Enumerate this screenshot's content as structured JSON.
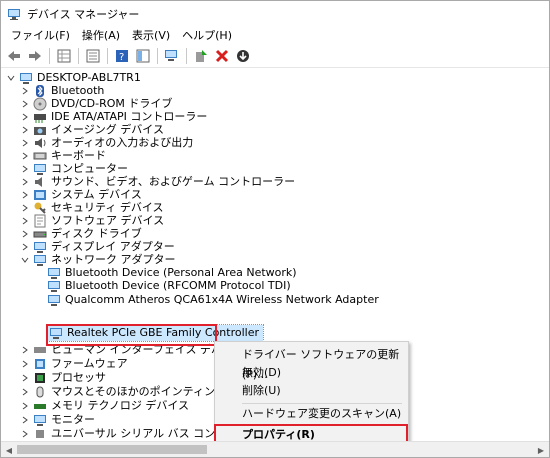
{
  "window": {
    "title": "デバイス マネージャー"
  },
  "menu": [
    "ファイル(F)",
    "操作(A)",
    "表示(V)",
    "ヘルプ(H)"
  ],
  "toolbar": [
    "back-icon",
    "forward-icon",
    "sep",
    "properties-grid-icon",
    "sep",
    "view-icon",
    "sep",
    "help-icon",
    "console-tree-icon",
    "sep",
    "scan-hardware-icon",
    "sep",
    "add-driver-icon",
    "uninstall-icon",
    "update-driver-icon"
  ],
  "tree": {
    "root": "DESKTOP-ABL7TR1",
    "categories": [
      {
        "label": "Bluetooth",
        "icon": "bluetooth-icon"
      },
      {
        "label": "DVD/CD-ROM ドライブ",
        "icon": "dvd-drive-icon"
      },
      {
        "label": "IDE ATA/ATAPI コントローラー",
        "icon": "ide-controller-icon"
      },
      {
        "label": "イメージング デバイス",
        "icon": "camera-icon"
      },
      {
        "label": "オーディオの入力および出力",
        "icon": "speaker-icon"
      },
      {
        "label": "キーボード",
        "icon": "keyboard-icon"
      },
      {
        "label": "コンピューター",
        "icon": "computer-icon"
      },
      {
        "label": "サウンド、ビデオ、およびゲーム コントローラー",
        "icon": "sound-icon"
      },
      {
        "label": "システム デバイス",
        "icon": "system-device-icon"
      },
      {
        "label": "セキュリティ デバイス",
        "icon": "security-key-icon"
      },
      {
        "label": "ソフトウェア デバイス",
        "icon": "software-device-icon"
      },
      {
        "label": "ディスク ドライブ",
        "icon": "disk-drive-icon"
      },
      {
        "label": "ディスプレイ アダプター",
        "icon": "display-adapter-icon"
      },
      {
        "label": "ネットワーク アダプター",
        "icon": "network-adapter-icon",
        "expanded": true
      }
    ],
    "network_children": [
      "Bluetooth Device (Personal Area Network)",
      "Bluetooth Device (RFCOMM Protocol TDI)",
      "Qualcomm Atheros QCA61x4A Wireless Network Adapter",
      "Realtek PCIe GBE Family Controller"
    ],
    "categories_after": [
      {
        "label": "ヒューマン インターフェイス デバイス",
        "icon": "hid-icon"
      },
      {
        "label": "ファームウェア",
        "icon": "firmware-icon"
      },
      {
        "label": "プロセッサ",
        "icon": "processor-icon"
      },
      {
        "label": "マウスとそのほかのポインティング デバイス",
        "icon": "mouse-icon"
      },
      {
        "label": "メモリ テクノロジ デバイス",
        "icon": "memory-icon"
      },
      {
        "label": "モニター",
        "icon": "monitor-icon"
      },
      {
        "label": "ユニバーサル シリアル バス コントローラー",
        "icon": "usb-icon"
      }
    ]
  },
  "context_menu": {
    "items": [
      "ドライバー ソフトウェアの更新(P)...",
      "無効(D)",
      "削除(U)",
      "ハードウェア変更のスキャン(A)",
      "プロパティ(R)"
    ]
  },
  "colors": {
    "accent": "#1e78d2",
    "highlight": "#e0202a",
    "selection": "#cce8ff"
  }
}
